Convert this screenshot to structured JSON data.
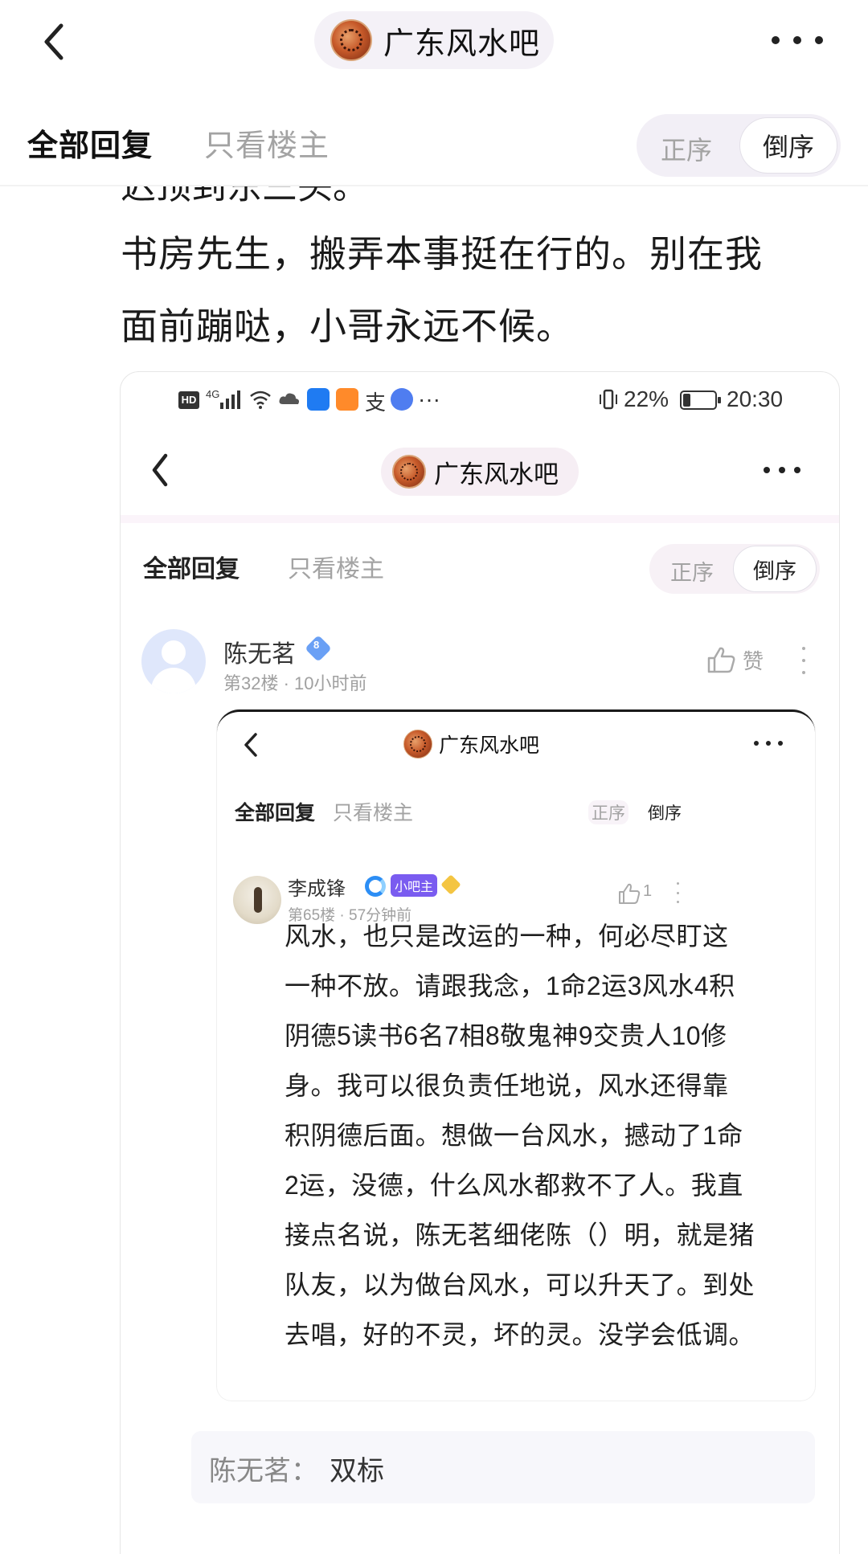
{
  "header": {
    "forum_title": "广东风水吧",
    "tabs": {
      "all": "全部回复",
      "op_only": "只看楼主"
    },
    "order": {
      "asc": "正序",
      "desc": "倒序"
    }
  },
  "post": {
    "cut_line": "迟顶到东三头。",
    "lines": [
      " 书房先生，搬弄本事挺在行的。别在我",
      "面前蹦哒，小哥永远不候。"
    ]
  },
  "screenshot": {
    "status_bar": {
      "hd": "HD",
      "signal": "4G",
      "more": "···",
      "battery_text": "22%",
      "time": "20:30"
    },
    "forum_title": "广东风水吧",
    "tabs": {
      "all": "全部回复",
      "op_only": "只看楼主"
    },
    "order": {
      "asc": "正序",
      "desc": "倒序"
    },
    "reply": {
      "name": "陈无茗",
      "level": "8",
      "meta": "第32楼 · 10小时前",
      "like_label": "赞"
    },
    "nested": {
      "forum_title": "广东风水吧",
      "tabs": {
        "all": "全部回复",
        "op_only": "只看楼主"
      },
      "order": {
        "asc": "正序",
        "desc": "倒序"
      },
      "reply": {
        "name": "李成锋",
        "role_badge": "小吧主",
        "meta": "第65楼 · 57分钟前",
        "like_count": "1",
        "lines": [
          "风水，也只是改运的一种，何必尽盯这",
          "一种不放。请跟我念，1命2运3风水4积",
          "阴德5读书6名7相8敬鬼神9交贵人10修",
          "身。我可以很负责任地说，风水还得靠",
          "积阴德后面。想做一台风水，撼动了1命",
          "2运，没德，什么风水都救不了人。我直",
          "接点名说，陈无茗细佬陈（）明，就是猪",
          "队友，以为做台风水，可以升天了。到处",
          "去唱，好的不灵，坏的灵。没学会低调。"
        ]
      }
    },
    "sub_reply": {
      "name": "陈无茗：",
      "text": "双标"
    }
  }
}
